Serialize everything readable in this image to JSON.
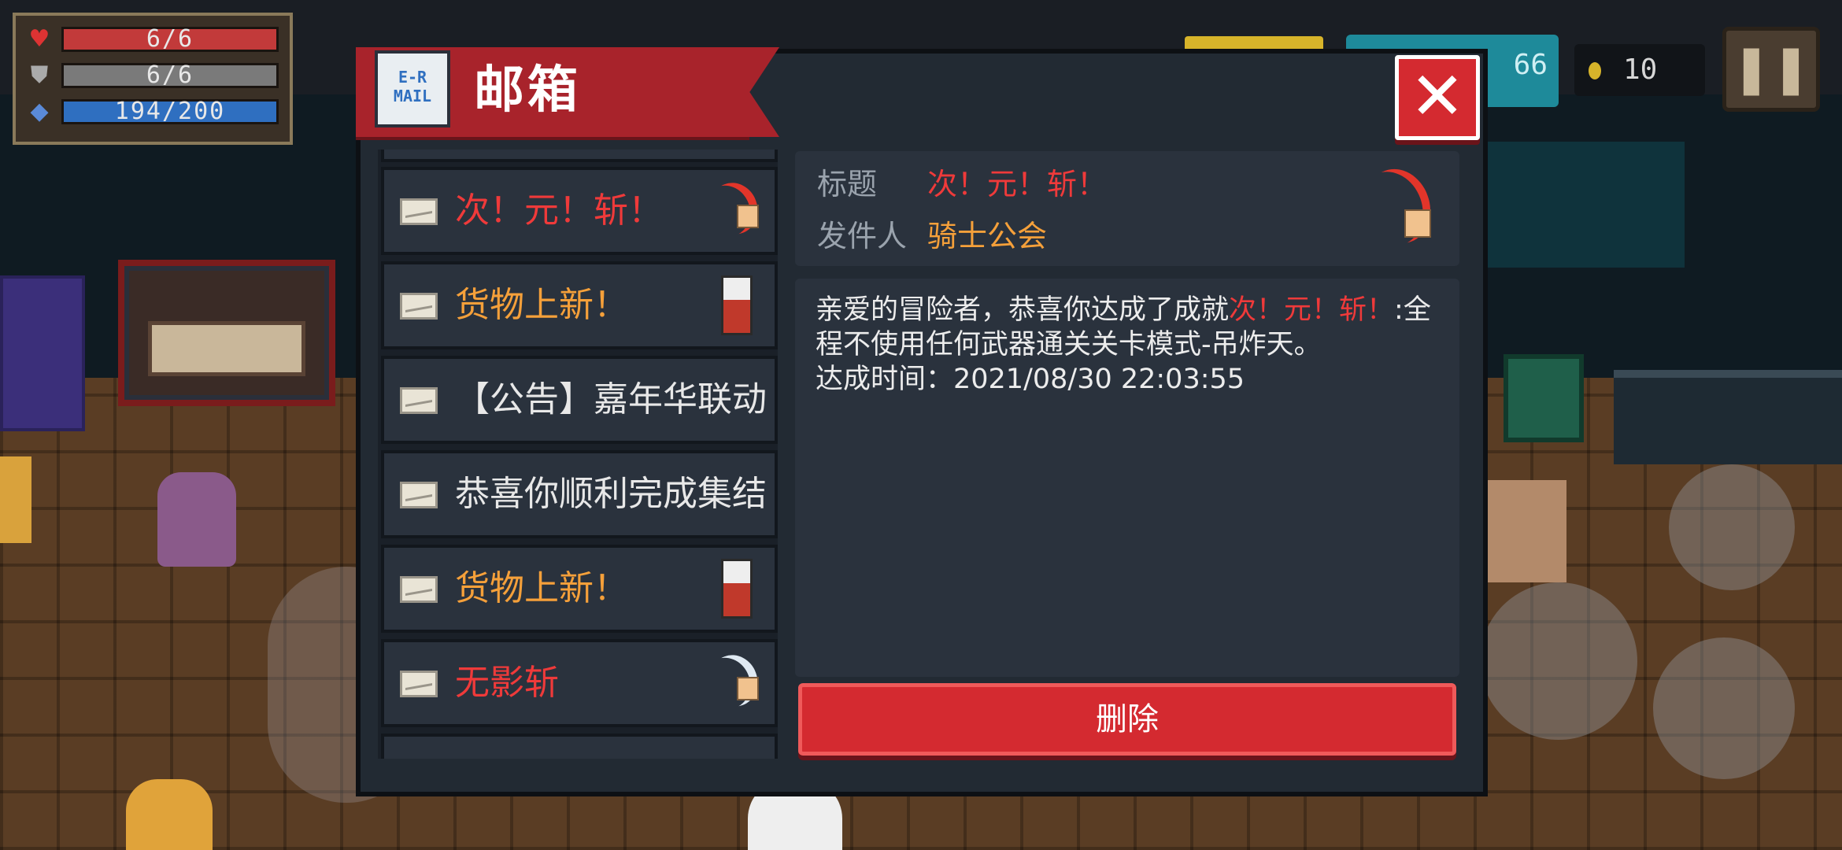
{
  "hud": {
    "hp": "6/6",
    "armor": "6/6",
    "energy": "194/200",
    "gems": "66",
    "coins": "10"
  },
  "mailbox": {
    "title": "邮箱",
    "mail_icon_text": "E-R MAIL",
    "items": [
      {
        "title": "次！元！斩！",
        "color": "#ef3a3a",
        "icon": "red-crescent-icon"
      },
      {
        "title": "货物上新！",
        "color": "#f5a03a",
        "icon": "merchant-icon"
      },
      {
        "title": "【公告】嘉年华联动",
        "color": "#e8e8e8",
        "icon": ""
      },
      {
        "title": "恭喜你顺利完成集结",
        "color": "#e8e8e8",
        "icon": ""
      },
      {
        "title": "货物上新！",
        "color": "#f5a03a",
        "icon": "merchant-icon"
      },
      {
        "title": "无影斩",
        "color": "#ef3a3a",
        "icon": "white-crescent-icon"
      }
    ],
    "detail": {
      "title_label": "标题",
      "title_value": "次！元！斩！",
      "sender_label": "发件人",
      "sender_value": "骑士公会",
      "body_prefix": "亲爱的冒险者，恭喜你达成了成就",
      "body_highlight": "次！元！斩！",
      "body_suffix": ":全程不使用任何武器通关关卡模式-吊炸天。",
      "time_line": "达成时间：2021/08/30 22:03:55"
    },
    "delete_label": "删除",
    "close_label": "✕"
  },
  "colors": {
    "accent_red": "#d42a30",
    "highlight_red": "#ef3a3a",
    "highlight_orange": "#f5a03a"
  }
}
